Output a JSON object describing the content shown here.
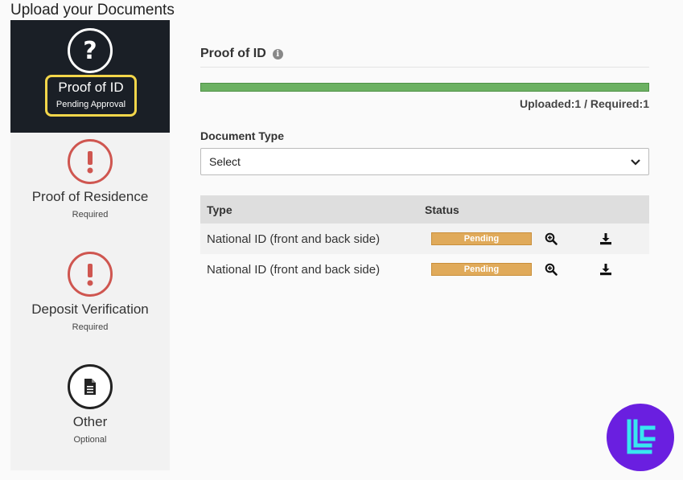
{
  "page": {
    "title": "Upload your Documents"
  },
  "sidebar": {
    "items": [
      {
        "label": "Proof of ID",
        "sub": "Pending Approval",
        "state": "active",
        "icon": "question-icon"
      },
      {
        "label": "Proof of Residence",
        "sub": "Required",
        "state": "required",
        "icon": "exclamation-icon"
      },
      {
        "label": "Deposit Verification",
        "sub": "Required",
        "state": "required",
        "icon": "exclamation-icon"
      },
      {
        "label": "Other",
        "sub": "Optional",
        "state": "optional",
        "icon": "document-icon"
      }
    ]
  },
  "main": {
    "section_title": "Proof of ID",
    "progress": {
      "fraction": 1.0
    },
    "upload_count": "Uploaded:1 / Required:1",
    "document_type": {
      "label": "Document Type",
      "selected": "Select"
    },
    "table": {
      "headers": {
        "type": "Type",
        "status": "Status"
      },
      "rows": [
        {
          "type": "National ID (front and back side)",
          "status": "Pending"
        },
        {
          "type": "National ID (front and back side)",
          "status": "Pending"
        }
      ]
    }
  },
  "colors": {
    "accent_yellow": "#f3d64a",
    "pending": "#e0aa5a",
    "progress": "#6cb162",
    "warning": "#cf5650",
    "logo": "#6a1fe0"
  }
}
